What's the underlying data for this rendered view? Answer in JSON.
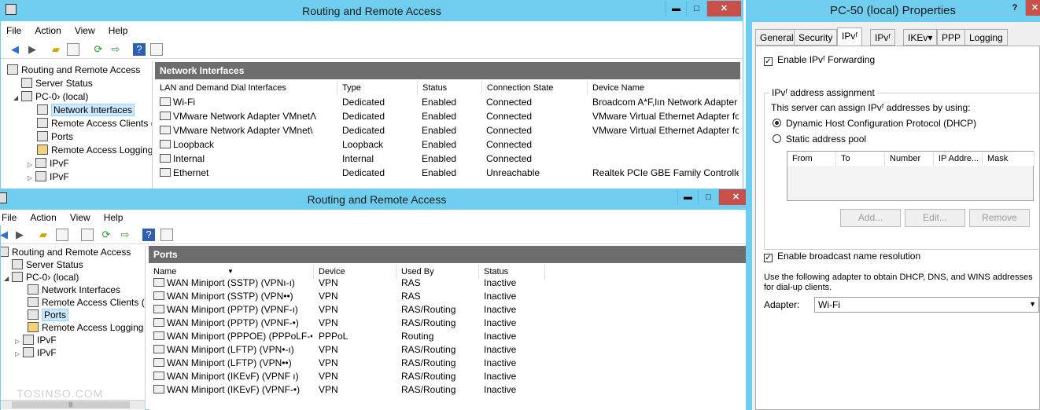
{
  "top_window": {
    "title": "Routing and Remote Access",
    "controls": {
      "minimize": "▬",
      "maximize": "□",
      "close": "✕"
    },
    "menu": [
      "File",
      "Action",
      "View",
      "Help"
    ],
    "tree": [
      {
        "label": "Routing and Remote Access"
      },
      {
        "label": "Server Status"
      },
      {
        "label": "PC-0› (local)"
      },
      {
        "label": "Network Interfaces"
      },
      {
        "label": "Remote Access Clients (‹"
      },
      {
        "label": "Ports"
      },
      {
        "label": "Remote Access Logging"
      },
      {
        "label": "IPvF"
      },
      {
        "label": "IPvF"
      }
    ],
    "pane_title": "Network Interfaces",
    "columns": [
      "LAN and Demand Dial Interfaces",
      "Type",
      "Status",
      "Connection State",
      "Device Name"
    ],
    "rows": [
      [
        "Wi-Fi",
        "Dedicated",
        "Enabled",
        "Connected",
        "Broadcom A*F,lın Network Adapter"
      ],
      [
        "VMware Network Adapter VMnetΛ",
        "Dedicated",
        "Enabled",
        "Connected",
        "VMware Virtual Ethernet Adapter fo..."
      ],
      [
        "VMware Network Adapter VMnet\\",
        "Dedicated",
        "Enabled",
        "Connected",
        "VMware Virtual Ethernet Adapter fo..."
      ],
      [
        "Loopback",
        "Loopback",
        "Enabled",
        "Connected",
        ""
      ],
      [
        "Internal",
        "Internal",
        "Enabled",
        "Connected",
        ""
      ],
      [
        "Ethernet",
        "Dedicated",
        "Enabled",
        "Unreachable",
        "Realtek PCIe GBE Family Controller"
      ]
    ]
  },
  "bottom_window": {
    "title": "Routing and Remote Access",
    "controls": {
      "minimize": "▬",
      "maximize": "□",
      "close": "✕"
    },
    "menu": [
      "File",
      "Action",
      "View",
      "Help"
    ],
    "tree": [
      {
        "label": "Routing and Remote Access"
      },
      {
        "label": "Server Status"
      },
      {
        "label": "PC-0› (local)"
      },
      {
        "label": "Network Interfaces"
      },
      {
        "label": "Remote Access Clients (‹"
      },
      {
        "label": "Ports"
      },
      {
        "label": "Remote Access Logging"
      },
      {
        "label": "IPvF"
      },
      {
        "label": "IPvF"
      }
    ],
    "pane_title": "Ports",
    "columns": [
      "Name",
      "Device",
      "Used By",
      "Status"
    ],
    "rows": [
      [
        "WAN Miniport (SSTP) (VPNı-ı)",
        "VPN",
        "RAS",
        "Inactive"
      ],
      [
        "WAN Miniport (SSTP) (VPN••)",
        "VPN",
        "RAS",
        "Inactive"
      ],
      [
        "WAN Miniport (PPTP) (VPNF-ı)",
        "VPN",
        "RAS/Routing",
        "Inactive"
      ],
      [
        "WAN Miniport (PPTP) (VPNF-•)",
        "VPN",
        "RAS/Routing",
        "Inactive"
      ],
      [
        "WAN Miniport (PPPOE) (PPPoLF-•)",
        "PPPoL",
        "Routing",
        "Inactive"
      ],
      [
        "WAN Miniport (LFTP) (VPN•-ı)",
        "VPN",
        "RAS/Routing",
        "Inactive"
      ],
      [
        "WAN Miniport (LFTP) (VPN••)",
        "VPN",
        "RAS/Routing",
        "Inactive"
      ],
      [
        "WAN Miniport (IKEvF) (VPNF ı)",
        "VPN",
        "RAS/Routing",
        "Inactive"
      ],
      [
        "WAN Miniport (IKEvF) (VPNF-•)",
        "VPN",
        "RAS/Routing",
        "Inactive"
      ]
    ],
    "watermark": "TOSINSO.COM",
    "scroll_grip": "|||"
  },
  "properties": {
    "title": "PC-50 (local) Properties",
    "controls": {
      "help": "?",
      "close": "✕"
    },
    "tabs": [
      "General",
      "Security",
      "IPvᶠ",
      "IPvᶠ",
      "IKEv▾",
      "PPP",
      "Logging"
    ],
    "enable_forwarding": "Enable IPvᶠ Forwarding",
    "assignment_group": "IPvᶠ address assignment",
    "assignment_text": "This server can assign IPvᶠ addresses by using:",
    "dhcp_option": "Dynamic Host Configuration Protocol (DHCP)",
    "static_option": "Static address pool",
    "pool_columns": [
      "From",
      "To",
      "Number",
      "IP Addre...",
      "Mask"
    ],
    "buttons": {
      "add": "Add...",
      "edit": "Edit...",
      "remove": "Remove"
    },
    "broadcast": "Enable broadcast name resolution",
    "adapter_text": "Use the following adapter to obtain DHCP, DNS, and WINS addresses for dial-up clients.",
    "adapter_label": "Adapter:",
    "adapter_value": "Wi-Fi",
    "checked_mark": "✓"
  }
}
